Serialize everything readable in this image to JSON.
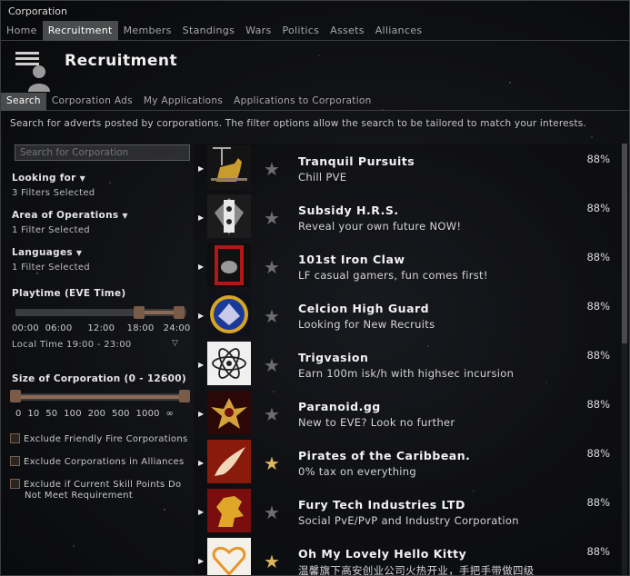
{
  "window": {
    "title": "Corporation"
  },
  "top_tabs": [
    {
      "label": "Home"
    },
    {
      "label": "Recruitment"
    },
    {
      "label": "Members"
    },
    {
      "label": "Standings"
    },
    {
      "label": "Wars"
    },
    {
      "label": "Politics"
    },
    {
      "label": "Assets"
    },
    {
      "label": "Alliances"
    }
  ],
  "header": {
    "title": "Recruitment"
  },
  "sub_tabs": [
    {
      "label": "Search"
    },
    {
      "label": "Corporation Ads"
    },
    {
      "label": "My Applications"
    },
    {
      "label": "Applications to Corporation"
    }
  ],
  "description": "Search for adverts posted by corporations. The filter options allow the search to be tailored to match your interests.",
  "sidebar": {
    "search_placeholder": "Search for Corporation",
    "looking_for": {
      "label": "Looking for",
      "value": "3 Filters Selected"
    },
    "area": {
      "label": "Area of Operations",
      "value": "1 Filter Selected"
    },
    "languages": {
      "label": "Languages",
      "value": "1 Filter Selected"
    },
    "playtime": {
      "label": "Playtime (EVE Time)",
      "ticks": [
        "00:00",
        "06:00",
        "12:00",
        "18:00",
        "24:00"
      ],
      "local": "Local Time 19:00 - 23:00"
    },
    "size": {
      "label": "Size of Corporation (0 - 12600)",
      "ticks": [
        "0",
        "10",
        "50",
        "100",
        "200",
        "500",
        "1000",
        "∞"
      ]
    },
    "checks": [
      {
        "label": "Exclude Friendly Fire Corporations"
      },
      {
        "label": "Exclude Corporations in Alliances"
      },
      {
        "label": "Exclude if Current Skill Points Do",
        "label2": "Not Meet Requirement"
      }
    ]
  },
  "results": [
    {
      "name": "Tranquil Pursuits",
      "tagline": "Chill PVE",
      "match": "88%",
      "logo": "horse-statue-logo",
      "star": "gray"
    },
    {
      "name": "Subsidy H.R.S.",
      "tagline": "Reveal your own future NOW!",
      "match": "88%",
      "logo": "heraldic-banner-logo",
      "star": "gray"
    },
    {
      "name": "101st Iron Claw",
      "tagline": "LF casual gamers, fun comes first!",
      "match": "88%",
      "logo": "iron-claw-logo",
      "star": "gray"
    },
    {
      "name": "Celcion High Guard",
      "tagline": "Looking for New Recruits",
      "match": "88%",
      "logo": "phoenix-shield-logo",
      "star": "gray"
    },
    {
      "name": "Trigvasion",
      "tagline": "Earn 100m isk/h with highsec incursion",
      "match": "88%",
      "logo": "atom-logo",
      "star": "gray"
    },
    {
      "name": "Paranoid.gg",
      "tagline": "New to EVE? Look no further",
      "match": "88%",
      "logo": "winged-emblem-logo",
      "star": "gray"
    },
    {
      "name": "Pirates of the Caribbean.",
      "tagline": "0% tax on everything",
      "match": "88%",
      "logo": "wing-logo",
      "star": "gold"
    },
    {
      "name": "Fury Tech Industries LTD",
      "tagline": "Social PvE/PvP and Industry Corporation",
      "match": "88%",
      "logo": "rearing-horse-logo",
      "star": "gray"
    },
    {
      "name": "Oh My Lovely Hello Kitty",
      "tagline": "温馨旗下高安创业公司火热开业，手把手带做四级",
      "match": "88%",
      "logo": "heart-logo",
      "star": "gold"
    }
  ],
  "colors": {
    "accent": "#8c6a55",
    "active_tab": "#4a4b4d",
    "star_gold": "#d9b75a",
    "star_gray": "#6d6d6d"
  }
}
